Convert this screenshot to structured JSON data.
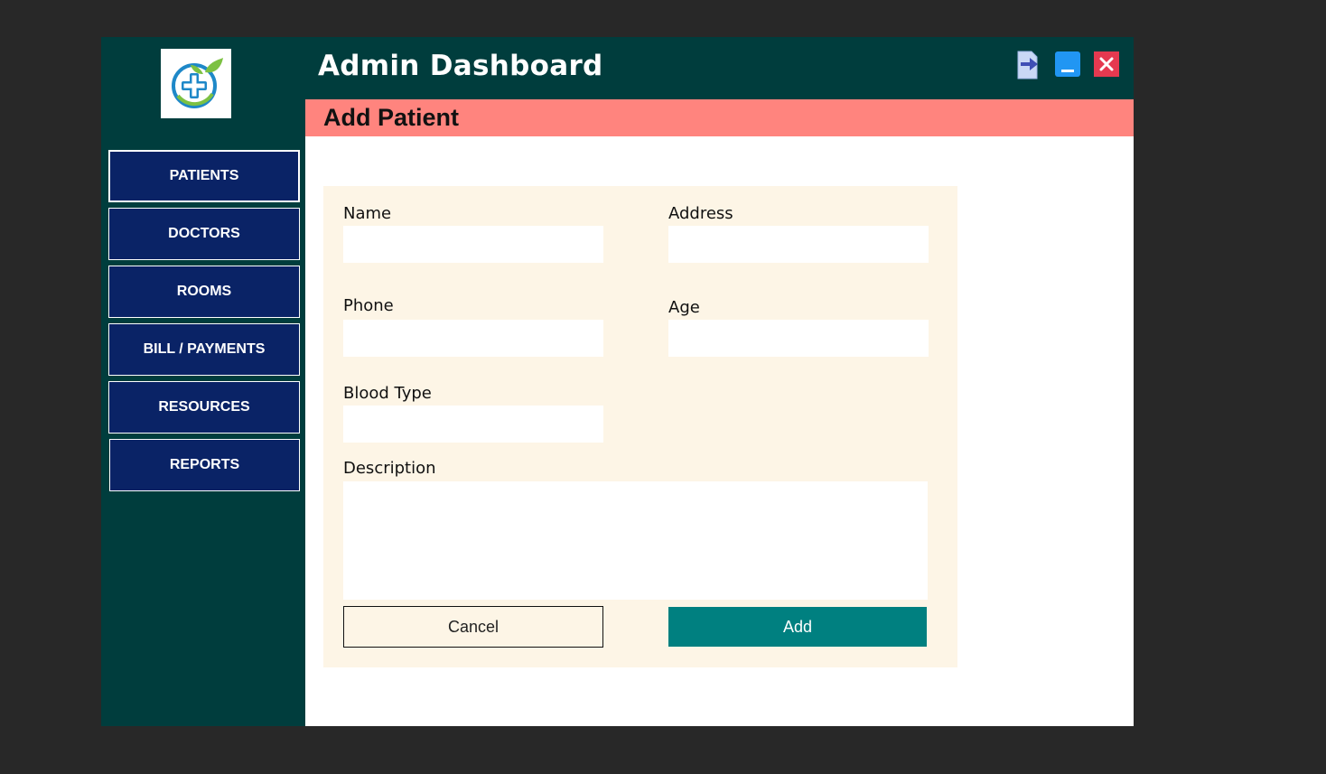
{
  "window": {
    "title": "Admin Dashboard",
    "controls": [
      {
        "name": "logout-icon",
        "color": "#c9d8f5"
      },
      {
        "name": "minimize-icon",
        "color": "#2196f3"
      },
      {
        "name": "close-icon",
        "color": "#e53950"
      }
    ]
  },
  "sidebar": {
    "logo": "hospital-cross-leaf-logo",
    "items": [
      {
        "label": "PATIENTS",
        "active": true
      },
      {
        "label": "DOCTORS",
        "active": false
      },
      {
        "label": "ROOMS",
        "active": false
      },
      {
        "label": "BILL / PAYMENTS",
        "active": false
      },
      {
        "label": "RESOURCES",
        "active": false
      },
      {
        "label": "REPORTS",
        "active": false
      }
    ]
  },
  "section": {
    "title": "Add Patient"
  },
  "form": {
    "fields": {
      "name": {
        "label": "Name",
        "value": "",
        "placeholder": ""
      },
      "address": {
        "label": "Address",
        "value": "",
        "placeholder": ""
      },
      "phone": {
        "label": "Phone",
        "value": "",
        "placeholder": ""
      },
      "age": {
        "label": "Age",
        "value": "",
        "placeholder": ""
      },
      "blood_type": {
        "label": "Blood Type",
        "value": "",
        "placeholder": ""
      },
      "description": {
        "label": "Description",
        "value": "",
        "placeholder": ""
      }
    },
    "buttons": {
      "cancel": "Cancel",
      "add": "Add"
    }
  },
  "colors": {
    "sidebar_bg": "#003d3d",
    "nav_button_bg": "#0a2366",
    "section_bar": "#ff847e",
    "form_bg": "#fdf5e6",
    "add_button": "#008080",
    "desktop_bg": "#282828"
  }
}
